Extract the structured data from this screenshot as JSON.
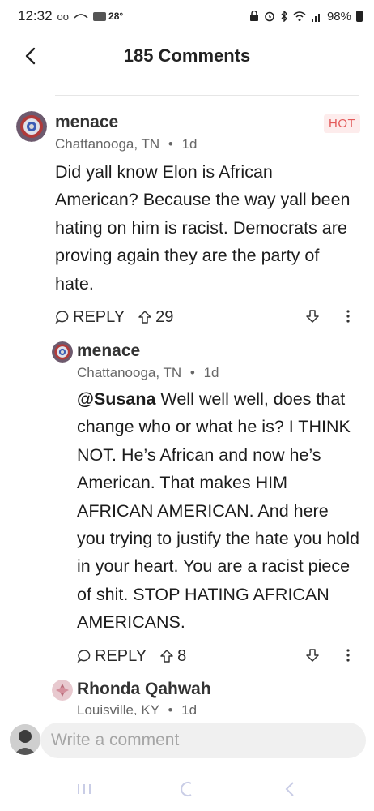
{
  "status_bar": {
    "time": "12:32",
    "voicemail_glyph": "oo",
    "temperature": "28°",
    "battery": "98%"
  },
  "header": {
    "title": "185 Comments"
  },
  "comments": [
    {
      "username": "menace",
      "location": "Chattanooga, TN",
      "age": "1d",
      "badge": "HOT",
      "body": "Did yall know Elon is African American? Because the way yall been hating on him is racist. Democrats are proving again they are the party of hate.",
      "reply_label": "REPLY",
      "upvotes": "29"
    },
    {
      "username": "menace",
      "location": "Chattanooga, TN",
      "age": "1d",
      "mention": "@Susana",
      "body": " Well well well, does that change who or what he is? I THINK NOT. He’s African and now he’s American. That makes HIM AFRICAN AMERICAN. And here you trying to justify the hate you hold in your heart. You are a racist piece of shit. STOP HATING AFRICAN AMERICANS.",
      "reply_label": "REPLY",
      "upvotes": "8"
    },
    {
      "username": "Rhonda Qahwah",
      "location": "Louisville, KY",
      "age": "1d"
    }
  ],
  "meta_separator": "•",
  "composer": {
    "placeholder": "Write a comment"
  },
  "icons": {
    "back": "chevron-left-icon",
    "reply": "speech-bubble-icon",
    "upvote": "arrow-up-icon",
    "downvote": "arrow-down-icon",
    "more": "more-vertical-icon",
    "nav_recents": "recents-icon",
    "nav_home": "home-icon",
    "nav_back": "back-icon"
  },
  "colors": {
    "badge_text": "#e35a5a",
    "badge_bg": "#fdecec",
    "nav_icons": "#c9cde6"
  }
}
